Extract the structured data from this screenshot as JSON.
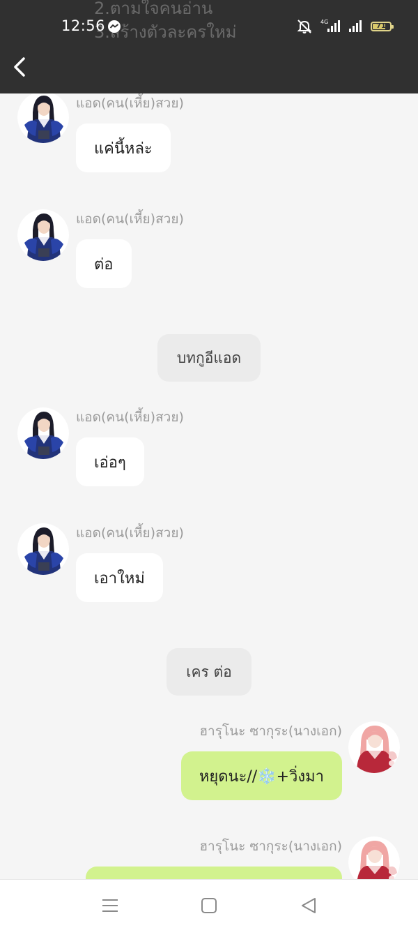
{
  "statusbar": {
    "time": "12:56",
    "network_label": "4G",
    "battery": "71",
    "battery_level": 0.71
  },
  "background_text": {
    "line1": "2.ตามใจคนอ่าน",
    "line2": "3.สร้างตัวละครใหม่"
  },
  "icons": {
    "back": "back-chevron-icon",
    "messenger": "messenger-icon",
    "mute": "mute-bell-icon",
    "signal": "signal-icon",
    "battery": "battery-icon",
    "nav_menu": "menu-icon",
    "nav_home": "home-square-icon",
    "nav_back": "back-triangle-icon"
  },
  "colors": {
    "top_bar": "#303030",
    "chat_background": "#f5f5f5",
    "left_bubble": "#ffffff",
    "right_bubble": "#d2f28e",
    "narration_bubble": "#ebebeb",
    "sender_name": "#9a9a9a"
  },
  "chat": {
    "messages": [
      {
        "sender": "แอด(คน(เหี้ย)สวย)",
        "text": "แค่นี้หล่ะ"
      },
      {
        "sender": "แอด(คน(เหี้ย)สวย)",
        "text": "ต่อ"
      },
      {
        "narration": "บทกูอีแอด"
      },
      {
        "sender": "แอด(คน(เหี้ย)สวย)",
        "text": "เอ่อๆ"
      },
      {
        "sender": "แอด(คน(เหี้ย)สวย)",
        "text": "เอาใหม่"
      },
      {
        "narration": "เคร ต่อ"
      },
      {
        "sender": "ฮารุโนะ ซากุระ(นางเอก)",
        "text": "หยุดนะ//❄️+วิ่งมา"
      },
      {
        "sender": "ฮารุโนะ ซากุระ(นางเอก)",
        "text": ""
      }
    ]
  }
}
